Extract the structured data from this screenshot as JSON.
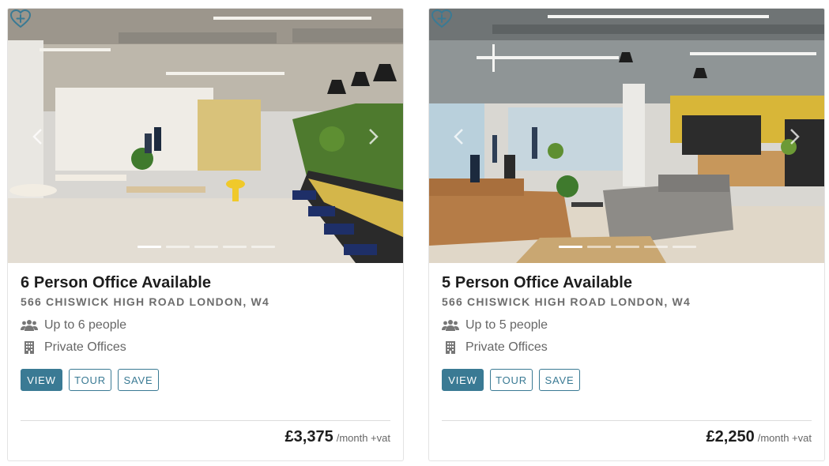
{
  "colors": {
    "accent": "#3a7a94",
    "text": "#1d1d1d",
    "muted": "#6d6d6d"
  },
  "listings": [
    {
      "title": "6 Person Office Available",
      "address": "566 CHISWICK HIGH ROAD LONDON, W4",
      "capacity": "Up to 6 people",
      "type": "Private Offices",
      "buttons": {
        "view": "VIEW",
        "tour": "TOUR",
        "save": "SAVE"
      },
      "price": "£3,375",
      "price_suffix": "/month +vat",
      "carousel": {
        "slides": 5,
        "active_slide": 1
      }
    },
    {
      "title": "5 Person Office Available",
      "address": "566 CHISWICK HIGH ROAD LONDON, W4",
      "capacity": "Up to 5 people",
      "type": "Private Offices",
      "buttons": {
        "view": "VIEW",
        "tour": "TOUR",
        "save": "SAVE"
      },
      "price": "£2,250",
      "price_suffix": "/month +vat",
      "carousel": {
        "slides": 5,
        "active_slide": 1
      }
    }
  ]
}
